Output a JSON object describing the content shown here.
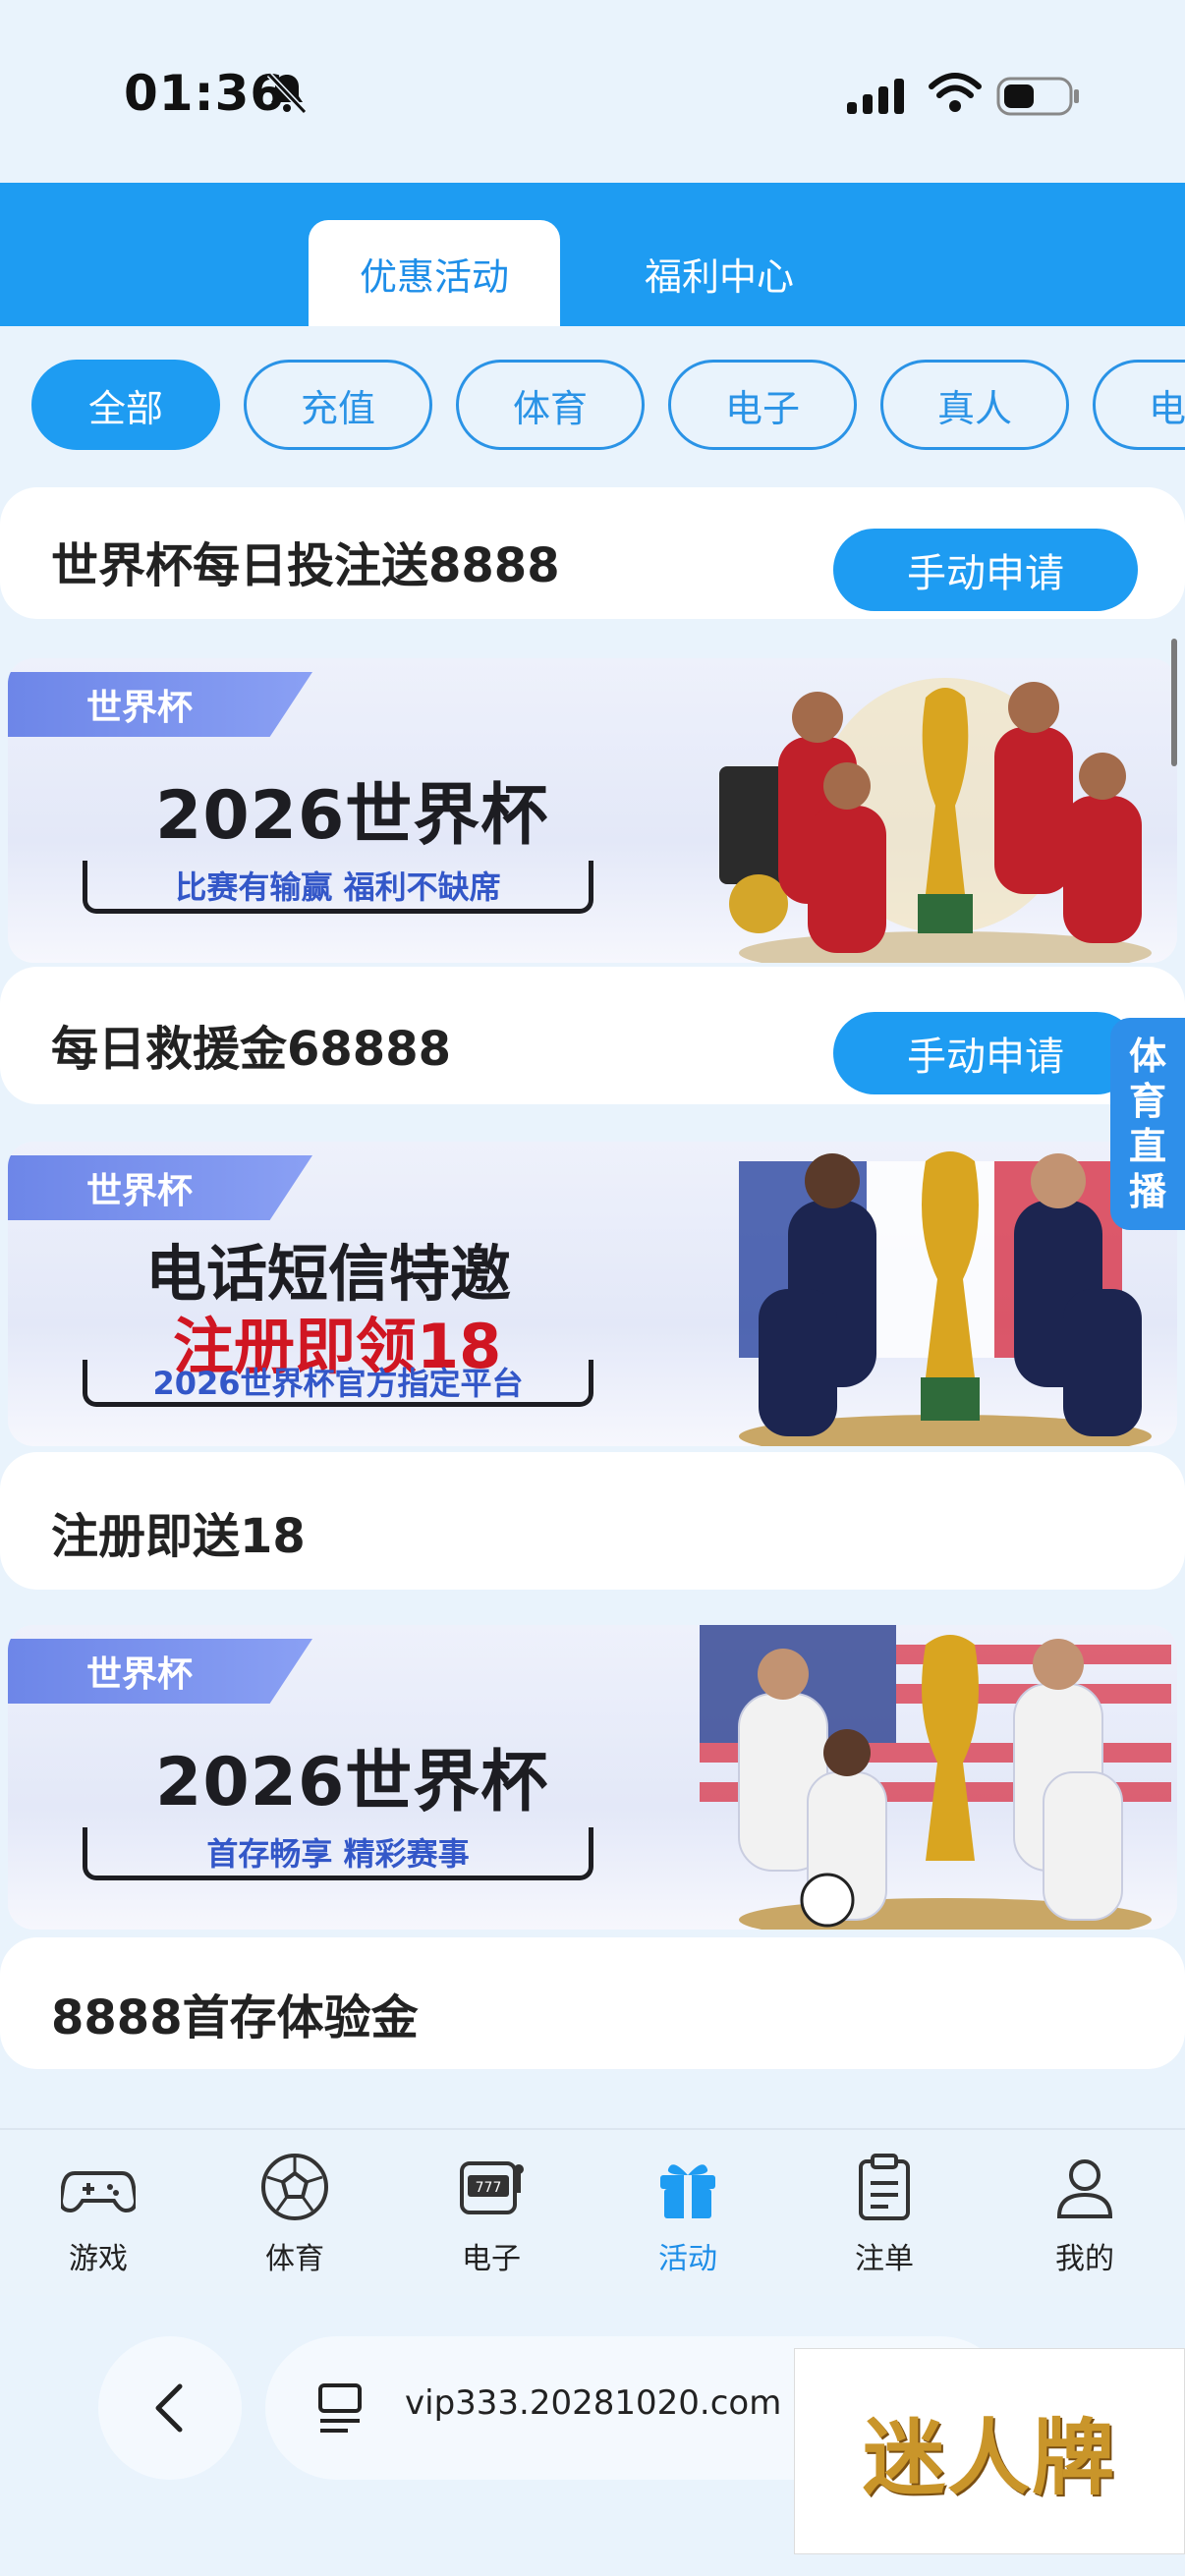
{
  "status_bar": {
    "time": "01:36"
  },
  "tabs": [
    {
      "label": "优惠活动",
      "active": true
    },
    {
      "label": "福利中心",
      "active": false
    }
  ],
  "categories": [
    "全部",
    "充值",
    "体育",
    "电子",
    "真人",
    "电"
  ],
  "promotions": [
    {
      "title": "世界杯每日投注送8888",
      "button": "手动申请"
    },
    {
      "title": "每日救援金68888",
      "button": "手动申请"
    },
    {
      "title": "注册即送18",
      "button": ""
    },
    {
      "title": "8888首存体验金",
      "button": ""
    }
  ],
  "banners": [
    {
      "tag": "世界杯",
      "headline": "2026世界杯",
      "sub": "比赛有输赢 福利不缺席"
    },
    {
      "tag": "世界杯",
      "headline": "电话短信特邀",
      "headline2": "注册即领18",
      "sub": "2026世界杯官方指定平台"
    },
    {
      "tag": "世界杯",
      "headline": "2026世界杯",
      "sub": "首存畅享 精彩赛事"
    }
  ],
  "live_tab": {
    "chars": [
      "体",
      "育",
      "直",
      "播"
    ]
  },
  "bottom_nav": [
    {
      "label": "游戏",
      "icon": "gamepad-icon"
    },
    {
      "label": "体育",
      "icon": "soccer-ball-icon"
    },
    {
      "label": "电子",
      "icon": "slot-machine-icon"
    },
    {
      "label": "活动",
      "icon": "gift-icon",
      "active": true
    },
    {
      "label": "注单",
      "icon": "clipboard-icon"
    },
    {
      "label": "我的",
      "icon": "user-icon"
    }
  ],
  "browser": {
    "url": "vip333.20281020.com"
  },
  "watermark": "迷人牌",
  "colors": {
    "accent": "#1e9cf2",
    "headline_red": "#d01622",
    "sub_blue": "#3357c8"
  }
}
